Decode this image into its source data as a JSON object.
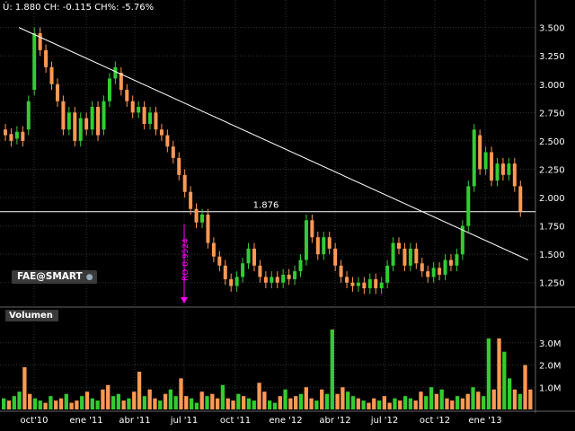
{
  "header": {
    "quote_text": "Ú: 1.880 CH: -0.115 CH%: -5.76%"
  },
  "badge": {
    "label": "FAE@SMART",
    "icon": "lock-icon"
  },
  "volume_panel": {
    "label": "Volumen"
  },
  "annotations": {
    "hline_label": "1.876",
    "marker_label": "RO 0.9524",
    "marker_color": "#ff00ff"
  },
  "colors": {
    "up": "#33cc33",
    "down": "#ff9955",
    "trendline": "#ffffff",
    "grid": "#333333"
  },
  "chart_data": [
    {
      "type": "candlestick",
      "title": "",
      "y_ticks": [
        "3.500",
        "3.250",
        "3.000",
        "2.750",
        "2.500",
        "2.250",
        "2.000",
        "1.750",
        "1.500",
        "1.250"
      ],
      "ylim": [
        1.05,
        3.6
      ],
      "x_ticks": [
        "oct'10",
        "ene '11",
        "abr '11",
        "jul '11",
        "oct '11",
        "ene '12",
        "abr '12",
        "jul '12",
        "oct '12",
        "ene '13"
      ],
      "horizontal_line": 1.876,
      "trendline": {
        "from": [
          0.7,
          3.5
        ],
        "to": [
          27.1,
          1.45
        ]
      },
      "series": [
        {
          "x": 0,
          "o": 2.6,
          "c": 2.55
        },
        {
          "x": 0.3,
          "o": 2.56,
          "c": 2.5
        },
        {
          "x": 0.6,
          "o": 2.52,
          "c": 2.58
        },
        {
          "x": 0.9,
          "o": 2.58,
          "c": 2.5
        },
        {
          "x": 1.2,
          "o": 2.6,
          "c": 2.85
        },
        {
          "x": 1.5,
          "o": 2.95,
          "c": 3.45
        },
        {
          "x": 1.8,
          "o": 3.45,
          "c": 3.3
        },
        {
          "x": 2.1,
          "o": 3.3,
          "c": 3.15
        },
        {
          "x": 2.4,
          "o": 3.15,
          "c": 3.0
        },
        {
          "x": 2.7,
          "o": 3.0,
          "c": 2.85
        },
        {
          "x": 3.0,
          "o": 2.85,
          "c": 2.6
        },
        {
          "x": 3.3,
          "o": 2.6,
          "c": 2.75
        },
        {
          "x": 3.6,
          "o": 2.75,
          "c": 2.5
        },
        {
          "x": 3.9,
          "o": 2.5,
          "c": 2.7
        },
        {
          "x": 4.2,
          "o": 2.7,
          "c": 2.6
        },
        {
          "x": 4.5,
          "o": 2.6,
          "c": 2.8
        },
        {
          "x": 4.8,
          "o": 2.8,
          "c": 2.55
        },
        {
          "x": 5.1,
          "o": 2.6,
          "c": 2.85
        },
        {
          "x": 5.4,
          "o": 2.85,
          "c": 3.05
        },
        {
          "x": 5.7,
          "o": 3.05,
          "c": 3.15
        },
        {
          "x": 6.0,
          "o": 3.1,
          "c": 2.95
        },
        {
          "x": 6.3,
          "o": 2.95,
          "c": 2.85
        },
        {
          "x": 6.6,
          "o": 2.85,
          "c": 2.75
        },
        {
          "x": 6.9,
          "o": 2.75,
          "c": 2.8
        },
        {
          "x": 7.2,
          "o": 2.8,
          "c": 2.65
        },
        {
          "x": 7.5,
          "o": 2.65,
          "c": 2.75
        },
        {
          "x": 7.8,
          "o": 2.75,
          "c": 2.6
        },
        {
          "x": 8.1,
          "o": 2.6,
          "c": 2.55
        },
        {
          "x": 8.4,
          "o": 2.55,
          "c": 2.45
        },
        {
          "x": 8.7,
          "o": 2.45,
          "c": 2.35
        },
        {
          "x": 9.0,
          "o": 2.35,
          "c": 2.2
        },
        {
          "x": 9.3,
          "o": 2.2,
          "c": 2.05
        },
        {
          "x": 9.6,
          "o": 2.05,
          "c": 1.9
        },
        {
          "x": 9.9,
          "o": 1.9,
          "c": 1.78
        },
        {
          "x": 10.2,
          "o": 1.78,
          "c": 1.85
        },
        {
          "x": 10.5,
          "o": 1.85,
          "c": 1.6
        },
        {
          "x": 10.8,
          "o": 1.6,
          "c": 1.48
        },
        {
          "x": 11.1,
          "o": 1.48,
          "c": 1.4
        },
        {
          "x": 11.4,
          "o": 1.4,
          "c": 1.28
        },
        {
          "x": 11.7,
          "o": 1.28,
          "c": 1.22
        },
        {
          "x": 12.0,
          "o": 1.22,
          "c": 1.3
        },
        {
          "x": 12.3,
          "o": 1.3,
          "c": 1.42
        },
        {
          "x": 12.6,
          "o": 1.42,
          "c": 1.55
        },
        {
          "x": 12.9,
          "o": 1.55,
          "c": 1.4
        },
        {
          "x": 13.2,
          "o": 1.4,
          "c": 1.3
        },
        {
          "x": 13.5,
          "o": 1.3,
          "c": 1.25
        },
        {
          "x": 13.8,
          "o": 1.25,
          "c": 1.3
        },
        {
          "x": 14.1,
          "o": 1.3,
          "c": 1.25
        },
        {
          "x": 14.4,
          "o": 1.25,
          "c": 1.32
        },
        {
          "x": 14.7,
          "o": 1.32,
          "c": 1.28
        },
        {
          "x": 15.0,
          "o": 1.28,
          "c": 1.35
        },
        {
          "x": 15.3,
          "o": 1.35,
          "c": 1.45
        },
        {
          "x": 15.6,
          "o": 1.45,
          "c": 1.8
        },
        {
          "x": 15.9,
          "o": 1.8,
          "c": 1.65
        },
        {
          "x": 16.2,
          "o": 1.65,
          "c": 1.5
        },
        {
          "x": 16.5,
          "o": 1.5,
          "c": 1.65
        },
        {
          "x": 16.8,
          "o": 1.65,
          "c": 1.55
        },
        {
          "x": 17.1,
          "o": 1.55,
          "c": 1.4
        },
        {
          "x": 17.4,
          "o": 1.4,
          "c": 1.3
        },
        {
          "x": 17.7,
          "o": 1.3,
          "c": 1.25
        },
        {
          "x": 18.0,
          "o": 1.25,
          "c": 1.22
        },
        {
          "x": 18.3,
          "o": 1.22,
          "c": 1.25
        },
        {
          "x": 18.6,
          "o": 1.25,
          "c": 1.2
        },
        {
          "x": 18.9,
          "o": 1.2,
          "c": 1.28
        },
        {
          "x": 19.2,
          "o": 1.28,
          "c": 1.2
        },
        {
          "x": 19.5,
          "o": 1.2,
          "c": 1.25
        },
        {
          "x": 19.8,
          "o": 1.25,
          "c": 1.4
        },
        {
          "x": 20.1,
          "o": 1.4,
          "c": 1.6
        },
        {
          "x": 20.4,
          "o": 1.6,
          "c": 1.55
        },
        {
          "x": 20.7,
          "o": 1.55,
          "c": 1.4
        },
        {
          "x": 21.0,
          "o": 1.4,
          "c": 1.55
        },
        {
          "x": 21.3,
          "o": 1.55,
          "c": 1.42
        },
        {
          "x": 21.6,
          "o": 1.42,
          "c": 1.35
        },
        {
          "x": 21.9,
          "o": 1.35,
          "c": 1.3
        },
        {
          "x": 22.2,
          "o": 1.3,
          "c": 1.38
        },
        {
          "x": 22.5,
          "o": 1.38,
          "c": 1.32
        },
        {
          "x": 22.8,
          "o": 1.32,
          "c": 1.45
        },
        {
          "x": 23.1,
          "o": 1.45,
          "c": 1.4
        },
        {
          "x": 23.4,
          "o": 1.4,
          "c": 1.5
        },
        {
          "x": 23.7,
          "o": 1.5,
          "c": 1.75
        },
        {
          "x": 24.0,
          "o": 1.75,
          "c": 2.1
        },
        {
          "x": 24.3,
          "o": 2.1,
          "c": 2.6
        },
        {
          "x": 24.6,
          "o": 2.55,
          "c": 2.25
        },
        {
          "x": 24.9,
          "o": 2.25,
          "c": 2.4
        },
        {
          "x": 25.2,
          "o": 2.4,
          "c": 2.15
        },
        {
          "x": 25.5,
          "o": 2.15,
          "c": 2.3
        },
        {
          "x": 25.8,
          "o": 2.3,
          "c": 2.2
        },
        {
          "x": 26.1,
          "o": 2.2,
          "c": 2.3
        },
        {
          "x": 26.4,
          "o": 2.3,
          "c": 2.1
        },
        {
          "x": 26.7,
          "o": 2.1,
          "c": 1.88
        }
      ]
    },
    {
      "type": "bar",
      "title": "",
      "y_ticks": [
        "3.0M",
        "2.0M",
        "1.0M"
      ],
      "ylim": [
        0,
        3.8
      ],
      "values": [
        0.5,
        0.4,
        0.6,
        0.8,
        1.9,
        0.7,
        0.5,
        0.4,
        0.3,
        0.6,
        0.4,
        0.5,
        0.7,
        0.3,
        0.4,
        0.6,
        0.8,
        0.5,
        0.4,
        0.9,
        1.1,
        0.6,
        0.7,
        0.4,
        0.5,
        0.8,
        1.7,
        0.6,
        0.9,
        0.5,
        0.4,
        0.7,
        0.9,
        0.6,
        1.4,
        0.6,
        0.5,
        0.3,
        0.8,
        0.6,
        0.7,
        0.5,
        1.1,
        0.5,
        0.4,
        0.7,
        0.6,
        0.5,
        0.4,
        1.2,
        0.8,
        0.4,
        0.3,
        0.6,
        0.9,
        0.5,
        0.6,
        0.7,
        1.0,
        0.5,
        0.4,
        0.9,
        0.7,
        3.6,
        0.7,
        1.0,
        0.8,
        0.6,
        0.5,
        0.4,
        0.3,
        0.5,
        0.4,
        0.6,
        0.3,
        0.5,
        0.4,
        0.6,
        0.5,
        0.4,
        0.8,
        0.6,
        1.0,
        0.7,
        0.9,
        0.5,
        0.4,
        0.6,
        0.5,
        0.7,
        1.0,
        0.8,
        0.6,
        3.2,
        0.9,
        3.2,
        2.6,
        1.4,
        0.9,
        0.7,
        2.0,
        0.9
      ],
      "colors_pattern": "alternating up/down per candle"
    }
  ]
}
